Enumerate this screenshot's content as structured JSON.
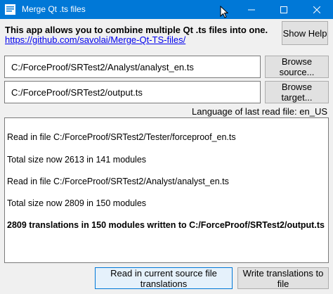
{
  "window": {
    "title": "Merge Qt .ts files",
    "accent": "#0078d7"
  },
  "header": {
    "intro": "This app allows you to combine multiple Qt .ts files into one.",
    "link": "https://github.com/savolai/Merge-Qt-TS-files/",
    "help_label": "Show Help"
  },
  "source": {
    "value": "C:/ForceProof/SRTest2/Analyst/analyst_en.ts",
    "browse_label": "Browse source..."
  },
  "target": {
    "value": "C:/ForceProof/SRTest2/output.ts",
    "browse_label": "Browse target..."
  },
  "language": "Language of last read file: en_US",
  "log": [
    "Read in file C:/ForceProof/SRTest2/Tester/forceproof_en.ts",
    "Total size now 2613 in 141 modules",
    "Read in file C:/ForceProof/SRTest2/Analyst/analyst_en.ts",
    "Total size now 2809 in 150 modules",
    "2809 translations in 150 modules written to C:/ForceProof/SRTest2/output.ts"
  ],
  "actions": {
    "read_label": "Read in current source file translations",
    "write_label": "Write translations to file"
  }
}
